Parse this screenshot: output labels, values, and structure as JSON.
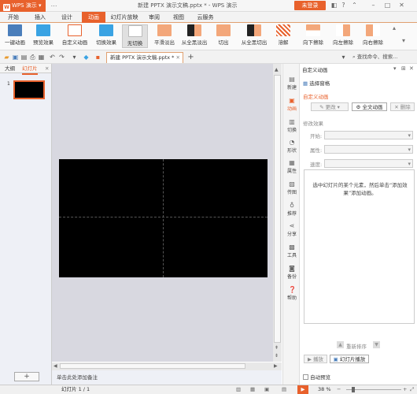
{
  "titlebar": {
    "app_name": "WPS 演示",
    "doc_title": "新建 PPTX 演示文稿.pptx * - WPS 演示",
    "login": "未登录"
  },
  "tabs": [
    "开始",
    "插入",
    "设计",
    "动画",
    "幻灯片放映",
    "审阅",
    "视图",
    "云服务"
  ],
  "ribbon": [
    {
      "label": "一键动画",
      "color": "#4a7ebb"
    },
    {
      "label": "预览效果",
      "color": "#3aa3e3"
    },
    {
      "label": "自定义动画",
      "color": "#e8612c"
    },
    {
      "label": "切换效果",
      "color": "#3aa3e3"
    },
    {
      "label": "无切换",
      "color": "#ffffff"
    },
    {
      "label": "平滑淡出",
      "color": "#f3a77a"
    },
    {
      "label": "从全黑淡出",
      "color": "#222222"
    },
    {
      "label": "切出",
      "color": "#f3a77a"
    },
    {
      "label": "从全黑切出",
      "color": "#222222"
    },
    {
      "label": "溶解",
      "color": "#f0f0f0"
    },
    {
      "label": "向下擦除",
      "color": "#f3a77a"
    },
    {
      "label": "向左擦除",
      "color": "#f3a77a"
    },
    {
      "label": "向右擦除",
      "color": "#f3a77a"
    }
  ],
  "doc_tab": "新建 PPTX 演示文稿.pptx *",
  "search": "查找命令、搜索...",
  "left_pane": {
    "tab_outline": "大纲",
    "tab_slides": "幻灯片",
    "slide_number": "1",
    "add": "+"
  },
  "notes": "单击此处添加备注",
  "status": {
    "slide": "幻灯片 1 / 1",
    "zoom": "38 %"
  },
  "sidebar": [
    "新建",
    "动画",
    "切换",
    "形状",
    "属性",
    "传图",
    "推荐",
    "分享",
    "工具",
    "备份",
    "帮助"
  ],
  "panel": {
    "title": "自定义动画",
    "select_pane": "选择窗格",
    "section_title": "自定义动画",
    "change": "更改",
    "full_text": "全文动画",
    "delete": "删除",
    "modify": "修改效果",
    "start": "开始:",
    "property": "属性:",
    "speed": "速度:",
    "hint": "选中幻灯片的某个元素，然后单击“添加效果”添加动画。",
    "reorder": "重新排序",
    "play": "播放",
    "slideshow": "幻灯片播放",
    "autopreview": "自动预览"
  }
}
